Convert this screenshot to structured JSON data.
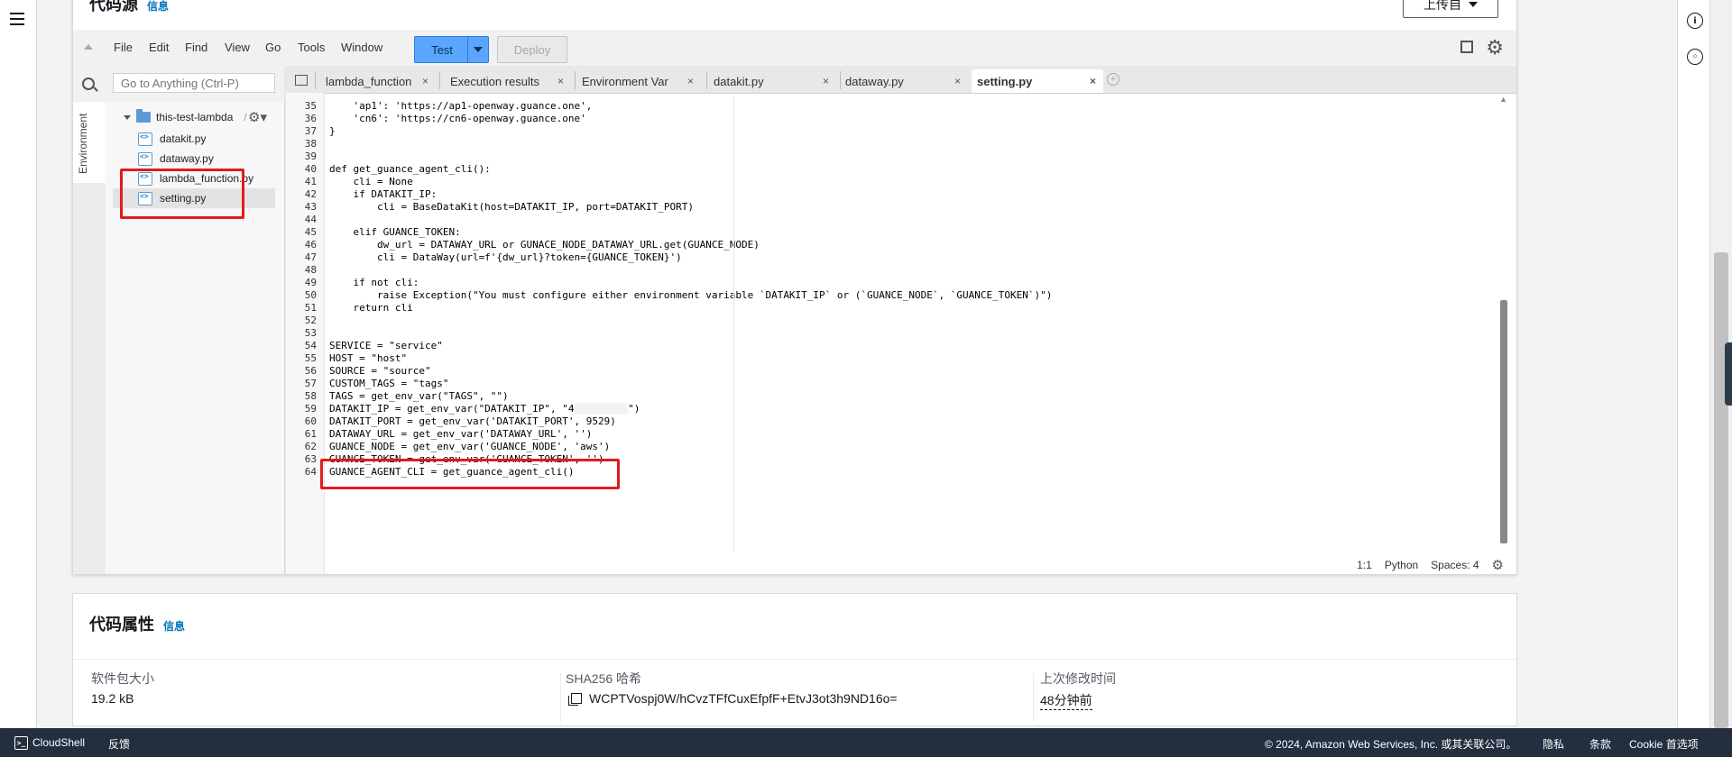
{
  "code_source": {
    "title": "代码源",
    "info_link": "信息",
    "upload_button": "上传自"
  },
  "menu": [
    "File",
    "Edit",
    "Find",
    "View",
    "Go",
    "Tools",
    "Window"
  ],
  "toolbar": {
    "test_label": "Test",
    "deploy_label": "Deploy"
  },
  "search": {
    "placeholder": "Go to Anything (Ctrl-P)"
  },
  "sidebar": {
    "env_label": "Environment",
    "root_folder": "this-test-lambda",
    "root_suffix": "/",
    "files": [
      "datakit.py",
      "dataway.py",
      "lambda_function.py",
      "setting.py"
    ]
  },
  "tabs": [
    {
      "label": "lambda_function",
      "close": "×"
    },
    {
      "label": "Execution results",
      "close": "×"
    },
    {
      "label": "Environment Var",
      "close": "×"
    },
    {
      "label": "datakit.py",
      "close": "×"
    },
    {
      "label": "dataway.py",
      "close": "×"
    },
    {
      "label": "setting.py",
      "close": "×"
    }
  ],
  "editor": {
    "line_numbers": [
      "35",
      "36",
      "37",
      "38",
      "39",
      "40",
      "41",
      "42",
      "43",
      "44",
      "45",
      "46",
      "47",
      "48",
      "49",
      "50",
      "51",
      "52",
      "53",
      "54",
      "55",
      "56",
      "57",
      "58",
      "59",
      "60",
      "61",
      "62",
      "63",
      "64"
    ],
    "lines": [
      "    'ap1': 'https://ap1-openway.guance.one',",
      "    'cn6': 'https://cn6-openway.guance.one'",
      "}",
      "",
      "",
      "def get_guance_agent_cli():",
      "    cli = None",
      "    if DATAKIT_IP:",
      "        cli = BaseDataKit(host=DATAKIT_IP, port=DATAKIT_PORT)",
      "",
      "    elif GUANCE_TOKEN:",
      "        dw_url = DATAWAY_URL or GUNACE_NODE_DATAWAY_URL.get(GUANCE_NODE)",
      "        cli = DataWay(url=f'{dw_url}?token={GUANCE_TOKEN}')",
      "",
      "    if not cli:",
      "        raise Exception(\"You must configure either environment variable `DATAKIT_IP` or (`GUANCE_NODE`, `GUANCE_TOKEN`)\")",
      "    return cli",
      "",
      "",
      "SERVICE = \"service\"",
      "HOST = \"host\"",
      "SOURCE = \"source\"",
      "CUSTOM_TAGS = \"tags\"",
      "TAGS = get_env_var(\"TAGS\", \"\")",
      "DATAKIT_IP = get_env_var(\"DATAKIT_IP\", \"4",
      "DATAKIT_PORT = get_env_var('DATAKIT_PORT', 9529)",
      "DATAWAY_URL = get_env_var('DATAWAY_URL', '')",
      "GUANCE_NODE = get_env_var('GUANCE_NODE', 'aws')",
      "GUANCE_TOKEN = get_env_var('GUANCE_TOKEN', '')",
      "GUANCE_AGENT_CLI = get_guance_agent_cli()"
    ],
    "line59_tail": "\")"
  },
  "status": {
    "position": "1:1",
    "language": "Python",
    "spaces": "Spaces: 4"
  },
  "properties": {
    "title": "代码属性",
    "info_link": "信息",
    "size_label": "软件包大小",
    "size_value": "19.2 kB",
    "sha_label": "SHA256 哈希",
    "sha_value": "WCPTVospj0W/hCvzTFfCuxEfpfF+EtvJ3ot3h9ND16o=",
    "modified_label": "上次修改时间",
    "modified_value": "48分钟前"
  },
  "footer": {
    "cloudshell": "CloudShell",
    "feedback": "反馈",
    "copyright": "© 2024, Amazon Web Services, Inc. 或其关联公司。",
    "privacy": "隐私",
    "terms": "条款",
    "cookie": "Cookie 首选项"
  },
  "colors": {
    "accent": "#0073bb",
    "test_button": "#5aa6ff",
    "highlight": "#e21b1b",
    "footer_bg": "#232f3e"
  }
}
